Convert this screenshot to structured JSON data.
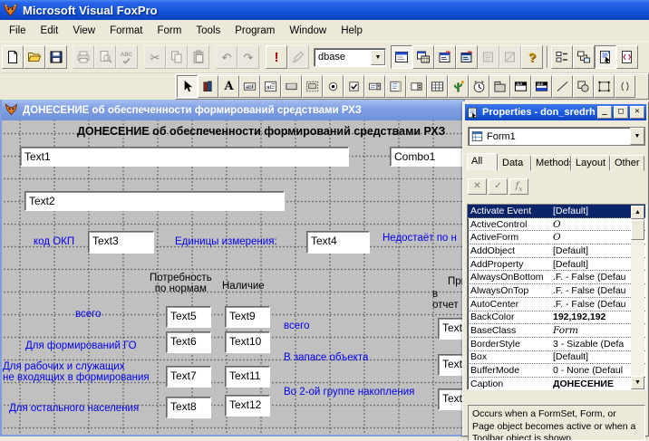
{
  "app": {
    "title": "Microsoft Visual FoxPro"
  },
  "menu_bar": {
    "items": [
      "File",
      "Edit",
      "View",
      "Format",
      "Form",
      "Tools",
      "Program",
      "Window",
      "Help"
    ]
  },
  "standard_toolbar": {
    "database_combo": {
      "value": "dbase"
    },
    "buttons": [
      "new",
      "open",
      "save",
      "print",
      "print-preview",
      "spelling",
      "cut",
      "copy",
      "paste",
      "undo",
      "redo",
      "run",
      "modify-form",
      "form-window",
      "data-session",
      "command-window",
      "view-window",
      "builder-a",
      "builder-b",
      "help",
      "tab-order",
      "data-environment",
      "properties-window",
      "code-window"
    ]
  },
  "form_controls_toolbar": {
    "buttons": [
      "select-objects",
      "view-classes",
      "label",
      "text-box",
      "edit-box",
      "command-button",
      "command-group",
      "option-group",
      "check-box",
      "combo-box",
      "list-box",
      "spinner",
      "grid",
      "image",
      "timer",
      "page-frame",
      "ole-container",
      "ole-bound-control",
      "line",
      "shape",
      "container",
      "separator"
    ]
  },
  "form_designer": {
    "window_title": "ДОНЕСЕНИЕ об обеспеченности формирований средствами РХЗ",
    "heading": "ДОНЕСЕНИЕ об обеспеченности формирований средствами РХЗ",
    "combo1": "Combo1",
    "textboxes": {
      "text1": "Text1",
      "text2": "Text2",
      "text3": "Text3",
      "text4": "Text4",
      "text5": "Text5",
      "text6": "Text6",
      "text7": "Text7",
      "text8": "Text8",
      "text9": "Text9",
      "text10": "Text10",
      "text11": "Text11",
      "text12": "Text12",
      "right1": "Text",
      "right2": "Text",
      "right3": "Text"
    },
    "labels": {
      "kod_okp": "код ОКП",
      "units": "Единицы измерения:",
      "nedostaet": "Недостаёт по н",
      "potrebnost": "Потребность\nпо нормам",
      "nalichie": "Наличие",
      "pri": "При",
      "v_otchet": "в отчет",
      "vsego_left": "всего",
      "dlya_formirovaniy": "Для формирований ГО",
      "dlya_rabochih": "Для рабочих и служащих\nне входящих в формирования",
      "dlya_ostalnogo": "Для остального населения",
      "vsego_right": "всего",
      "v_zapase": "В запасе объекта",
      "vo_2oy": "Во 2-ой группе накопления"
    }
  },
  "properties_window": {
    "title": "Properties - don_sredrh",
    "window_buttons": [
      "minimize",
      "maximize",
      "close"
    ],
    "object_selector": "Form1",
    "tabs": [
      "All",
      "Data",
      "Methods",
      "Layout",
      "Other"
    ],
    "active_tab": "All",
    "tools": [
      "cancel",
      "accept",
      "function"
    ],
    "rows": [
      {
        "name": "Activate Event",
        "value": "[Default]"
      },
      {
        "name": "ActiveControl",
        "value": "O"
      },
      {
        "name": "ActiveForm",
        "value": "O"
      },
      {
        "name": "AddObject",
        "value": "[Default]"
      },
      {
        "name": "AddProperty",
        "value": "[Default]"
      },
      {
        "name": "AlwaysOnBottom",
        "value": ".F. - False (Defau"
      },
      {
        "name": "AlwaysOnTop",
        "value": ".F. - False (Defau"
      },
      {
        "name": "AutoCenter",
        "value": ".F. - False (Defau"
      },
      {
        "name": "BackColor",
        "value": "192,192,192"
      },
      {
        "name": "BaseClass",
        "value": "Form"
      },
      {
        "name": "BorderStyle",
        "value": "3 - Sizable (Defa"
      },
      {
        "name": "Box",
        "value": "[Default]"
      },
      {
        "name": "BufferMode",
        "value": "0 - None (Defaul"
      },
      {
        "name": "Caption",
        "value": "ДОНЕСЕНИЕ"
      }
    ],
    "selected_row": "Activate Event",
    "description": "Occurs when a FormSet, Form, or Page object becomes active or when a Toolbar object is shown."
  },
  "colors": {
    "titlebar_blue": "#1557dd",
    "inactive_titlebar_blue": "#7e9ee3",
    "canvas_gray": "#c0c0c0",
    "label_blue": "#0000f0",
    "chrome": "#ece9d8",
    "selection_navy": "#0a246a"
  }
}
